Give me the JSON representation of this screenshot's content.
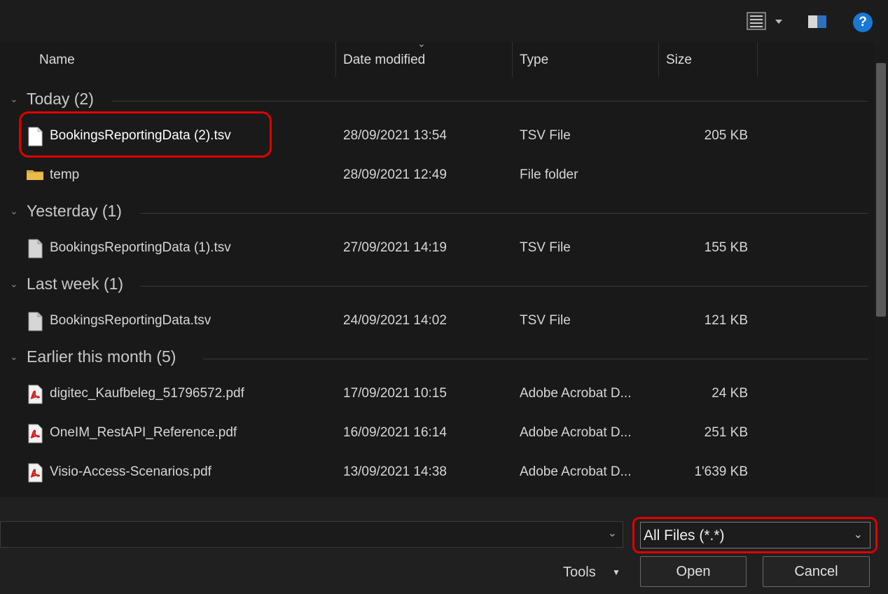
{
  "toolbar": {
    "view_icon": "details-view-icon",
    "view_dropdown_icon": "dropdown-arrow-icon",
    "preview_icon": "preview-pane-icon",
    "help_icon": "help-icon",
    "help_label": "?"
  },
  "columns": {
    "name": "Name",
    "date": "Date modified",
    "type": "Type",
    "size": "Size"
  },
  "groups": [
    {
      "label": "Today (2)",
      "items": [
        {
          "name": "BookingsReportingData (2).tsv",
          "date": "28/09/2021 13:54",
          "type": "TSV File",
          "size": "205 KB",
          "icon": "file-icon"
        },
        {
          "name": "temp",
          "date": "28/09/2021 12:49",
          "type": "File folder",
          "size": "",
          "icon": "folder-icon"
        }
      ]
    },
    {
      "label": "Yesterday (1)",
      "items": [
        {
          "name": "BookingsReportingData (1).tsv",
          "date": "27/09/2021 14:19",
          "type": "TSV File",
          "size": "155 KB",
          "icon": "file-icon"
        }
      ]
    },
    {
      "label": "Last week (1)",
      "items": [
        {
          "name": "BookingsReportingData.tsv",
          "date": "24/09/2021 14:02",
          "type": "TSV File",
          "size": "121 KB",
          "icon": "file-icon"
        }
      ]
    },
    {
      "label": "Earlier this month (5)",
      "items": [
        {
          "name": "digitec_Kaufbeleg_51796572.pdf",
          "date": "17/09/2021 10:15",
          "type": "Adobe Acrobat D...",
          "size": "24 KB",
          "icon": "pdf-icon"
        },
        {
          "name": "OneIM_RestAPI_Reference.pdf",
          "date": "16/09/2021 16:14",
          "type": "Adobe Acrobat D...",
          "size": "251 KB",
          "icon": "pdf-icon"
        },
        {
          "name": "Visio-Access-Scenarios.pdf",
          "date": "13/09/2021 14:38",
          "type": "Adobe Acrobat D...",
          "size": "1'639 KB",
          "icon": "pdf-icon"
        }
      ]
    }
  ],
  "bottom": {
    "filename_value": "",
    "file_type_filter": "All Files (*.*)",
    "tools_label": "Tools",
    "open_label": "Open",
    "cancel_label": "Cancel"
  },
  "colors": {
    "highlight": "#e00000",
    "background": "#191919",
    "help_blue": "#1a78d4"
  }
}
